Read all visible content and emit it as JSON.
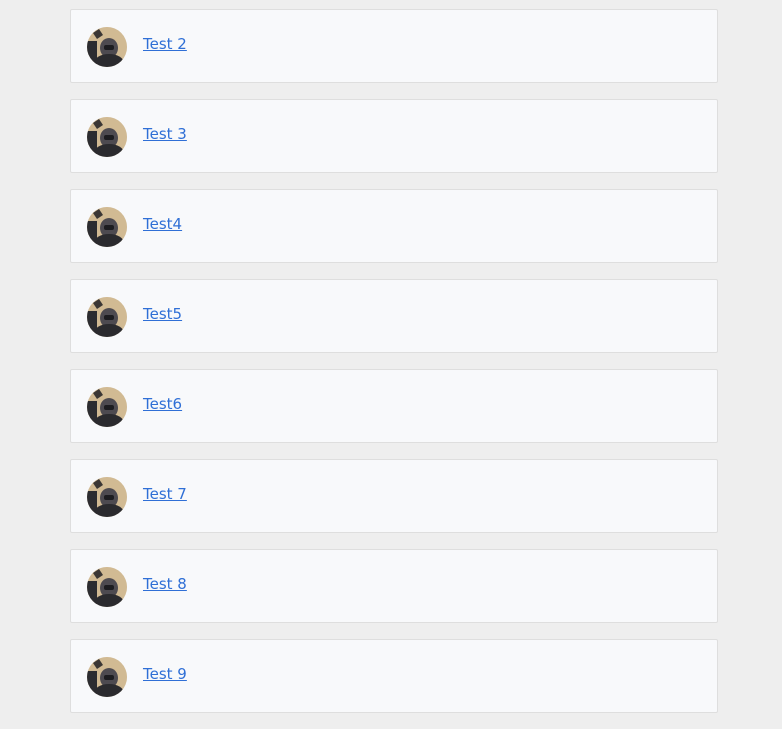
{
  "users": [
    {
      "name": "Test 2",
      "avatar_icon": "user-photo-icon"
    },
    {
      "name": "Test 3",
      "avatar_icon": "user-photo-icon"
    },
    {
      "name": "Test4",
      "avatar_icon": "user-photo-icon"
    },
    {
      "name": "Test5",
      "avatar_icon": "user-photo-icon"
    },
    {
      "name": "Test6",
      "avatar_icon": "user-photo-icon"
    },
    {
      "name": "Test 7",
      "avatar_icon": "user-photo-icon"
    },
    {
      "name": "Test 8",
      "avatar_icon": "user-photo-icon"
    },
    {
      "name": "Test 9",
      "avatar_icon": "user-photo-icon"
    }
  ],
  "colors": {
    "link": "#2f6fd6",
    "card_background": "#f8f9fb",
    "page_background": "#eeeeee"
  }
}
